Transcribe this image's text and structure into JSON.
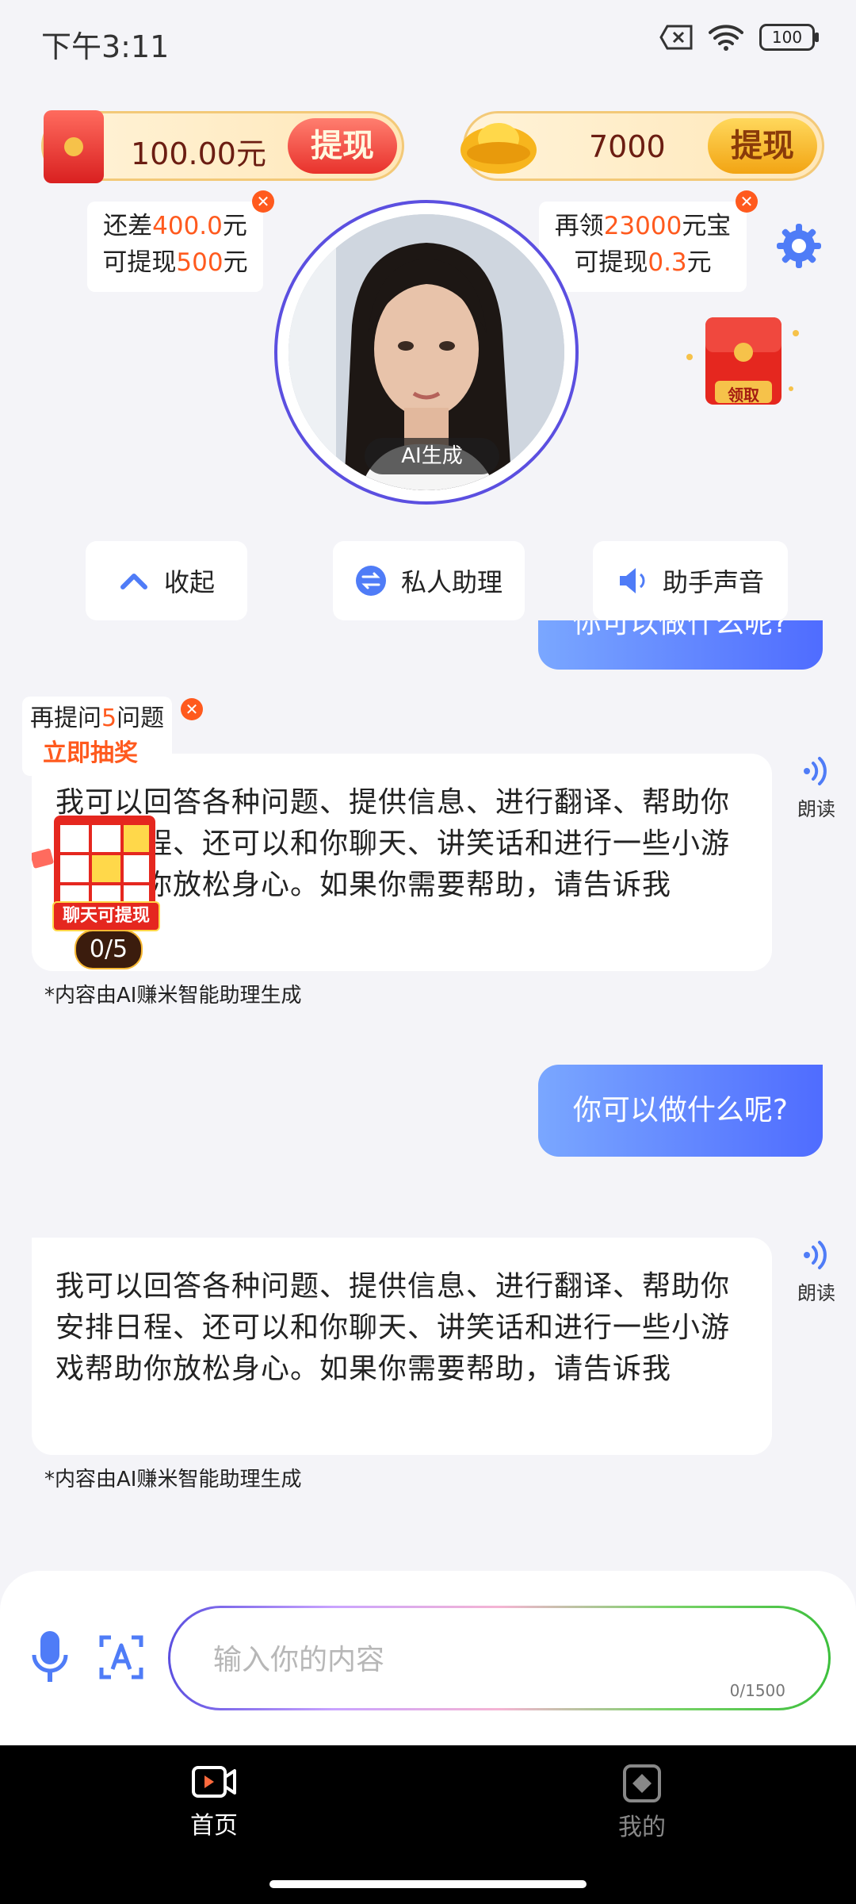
{
  "status": {
    "time": "下午3:11",
    "battery": "100"
  },
  "cash_card": {
    "amount": "100.00元",
    "button": "提现"
  },
  "gold_card": {
    "amount": "7000",
    "button": "提现"
  },
  "tip_left": {
    "line1_pre": "还差",
    "line1_hl": "400.0",
    "line1_post": "元",
    "line2_pre": "可提现",
    "line2_hl": "500",
    "line2_post": "元"
  },
  "tip_right": {
    "line1_pre": "再领",
    "line1_hl": "23000",
    "line1_post": "元宝",
    "line2_pre": "可提现",
    "line2_hl": "0.3",
    "line2_post": "元"
  },
  "avatar": {
    "tag": "AI生成"
  },
  "gift": {
    "label": "领取"
  },
  "actions": {
    "collapse": "收起",
    "assistant": "私人助理",
    "voice": "助手声音"
  },
  "promo": {
    "line1_pre": "再提问",
    "line1_hl": "5",
    "line1_post": "问题",
    "line2": "立即抽奖",
    "grid_title": "聊天可提现",
    "count": "0/5"
  },
  "chat": {
    "user_message": "你可以做什么呢?",
    "ai_message": "我可以回答各种问题、提供信息、进行翻译、帮助你安排日程、还可以和你聊天、讲笑话和进行一些小游戏帮助你放松身心。如果你需要帮助，请告诉我",
    "note": "*内容由AI赚米智能助理生成",
    "read_label": "朗读"
  },
  "input": {
    "placeholder": "输入你的内容",
    "counter": "0/1500"
  },
  "nav": {
    "home": "首页",
    "mine": "我的"
  },
  "colors": {
    "accent": "#5b4fe0",
    "highlight": "#ff5a1e",
    "user_bubble": "#4f6cff"
  }
}
